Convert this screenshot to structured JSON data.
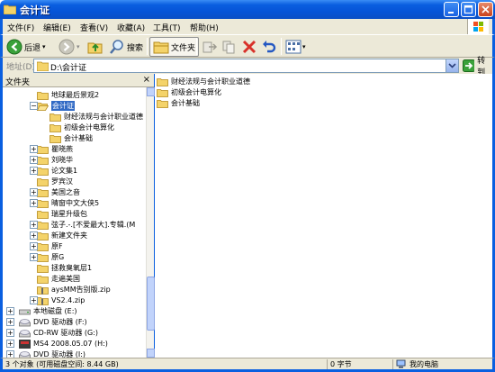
{
  "window": {
    "title": "会计证"
  },
  "menu": [
    "文件(F)",
    "编辑(E)",
    "查看(V)",
    "收藏(A)",
    "工具(T)",
    "帮助(H)"
  ],
  "toolbar": {
    "back_label": "后退",
    "search_label": "搜索",
    "folders_label": "文件夹"
  },
  "address": {
    "label": "地址(D)",
    "value": "D:\\会计证",
    "go_label": "转到"
  },
  "tree": {
    "header": "文件夹",
    "close_glyph": "×",
    "items": [
      {
        "label": "地球最后景观2",
        "level": 2,
        "expander": "none",
        "icon": "folder"
      },
      {
        "label": "会计证",
        "level": 2,
        "expander": "minus",
        "icon": "folder-open",
        "selected": true
      },
      {
        "label": "财经法规与会计职业道德",
        "level": 3,
        "expander": "none",
        "icon": "folder"
      },
      {
        "label": "初级会计电算化",
        "level": 3,
        "expander": "none",
        "icon": "folder"
      },
      {
        "label": "会计基础",
        "level": 3,
        "expander": "none",
        "icon": "folder"
      },
      {
        "label": "瞿晓燕",
        "level": 2,
        "expander": "plus",
        "icon": "folder"
      },
      {
        "label": "刘晓华",
        "level": 2,
        "expander": "plus",
        "icon": "folder"
      },
      {
        "label": "论文集1",
        "level": 2,
        "expander": "plus",
        "icon": "folder"
      },
      {
        "label": "罗宾汉",
        "level": 2,
        "expander": "none",
        "icon": "folder"
      },
      {
        "label": "美国之音",
        "level": 2,
        "expander": "plus",
        "icon": "folder"
      },
      {
        "label": "晴窗中文大侠5",
        "level": 2,
        "expander": "plus",
        "icon": "folder"
      },
      {
        "label": "瑞星升级包",
        "level": 2,
        "expander": "none",
        "icon": "folder"
      },
      {
        "label": "弦子.-.[不爱最大].专辑.(M",
        "level": 2,
        "expander": "plus",
        "icon": "folder"
      },
      {
        "label": "新建文件夹",
        "level": 2,
        "expander": "plus",
        "icon": "folder"
      },
      {
        "label": "原F",
        "level": 2,
        "expander": "plus",
        "icon": "folder"
      },
      {
        "label": "原G",
        "level": 2,
        "expander": "plus",
        "icon": "folder"
      },
      {
        "label": "拯救臭氧层1",
        "level": 2,
        "expander": "none",
        "icon": "folder"
      },
      {
        "label": "走遍美国",
        "level": 2,
        "expander": "none",
        "icon": "folder"
      },
      {
        "label": "aysMM告别版.zip",
        "level": 2,
        "expander": "none",
        "icon": "zip"
      },
      {
        "label": "VS2.4.zip",
        "level": 2,
        "expander": "plus",
        "icon": "zip"
      },
      {
        "label": "本地磁盘 (E:)",
        "level": 1,
        "expander": "plus",
        "icon": "disk"
      },
      {
        "label": "DVD 驱动器 (F:)",
        "level": 1,
        "expander": "plus",
        "icon": "dvd"
      },
      {
        "label": "CD-RW 驱动器 (G:)",
        "level": 1,
        "expander": "plus",
        "icon": "cd"
      },
      {
        "label": "MS4 2008.05.07 (H:)",
        "level": 1,
        "expander": "plus",
        "icon": "dvd-media"
      },
      {
        "label": "DVD 驱动器 (I:)",
        "level": 1,
        "expander": "plus",
        "icon": "dvd"
      }
    ]
  },
  "content": {
    "items": [
      "财经法规与会计职业道德",
      "初级会计电算化",
      "会计基础"
    ]
  },
  "status": {
    "objects": "3 个对象 (可用磁盘空间: 8.44 GB)",
    "size": "0 字节",
    "location": "我的电脑"
  },
  "colors": {
    "title_blue": "#0a5fe0",
    "chrome": "#ece9d8",
    "selection": "#316ac5",
    "folder": "#f4d36a"
  }
}
